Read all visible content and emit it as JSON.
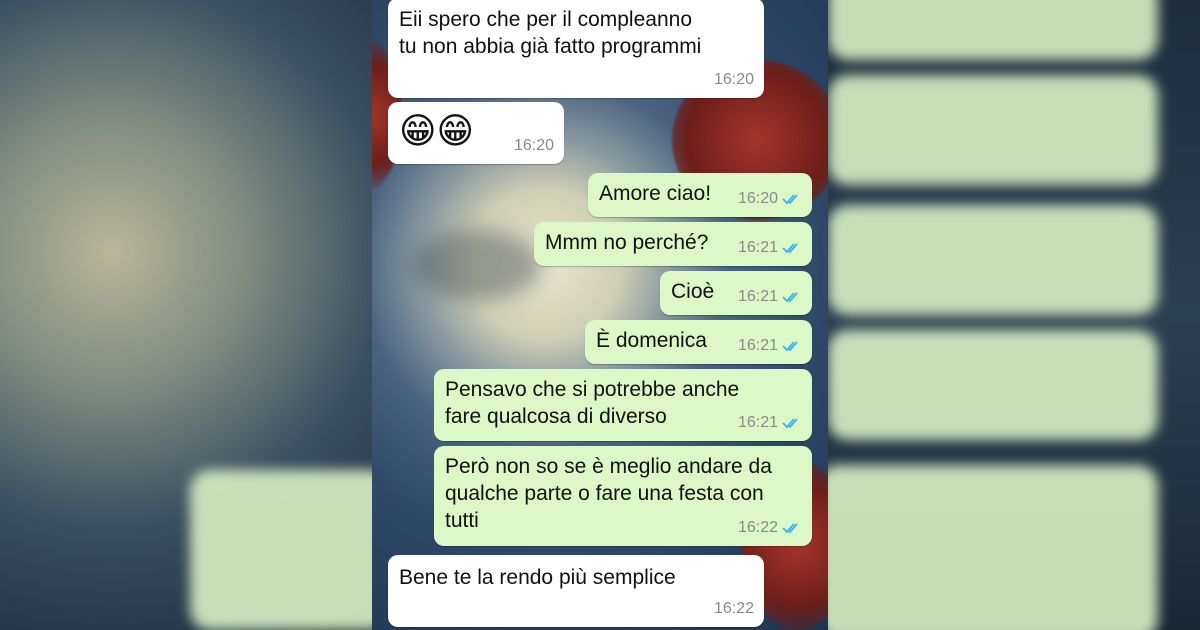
{
  "messages": [
    {
      "dir": "in",
      "lines": [
        "Eii spero che per il compleanno",
        "tu non abbia già fatto programmi"
      ],
      "time": "16:20"
    },
    {
      "dir": "in",
      "emoji": "😁😁",
      "time": "16:20"
    },
    {
      "dir": "out",
      "lines": [
        "Amore ciao!"
      ],
      "time": "16:20",
      "read": true
    },
    {
      "dir": "out",
      "lines": [
        "Mmm no perché?"
      ],
      "time": "16:21",
      "read": true
    },
    {
      "dir": "out",
      "lines": [
        "Cioè"
      ],
      "time": "16:21",
      "read": true
    },
    {
      "dir": "out",
      "lines": [
        "È domenica"
      ],
      "time": "16:21",
      "read": true
    },
    {
      "dir": "out",
      "lines": [
        "Pensavo che si potrebbe anche",
        "fare qualcosa di diverso"
      ],
      "time": "16:21",
      "read": true
    },
    {
      "dir": "out",
      "lines": [
        "Però non so se è meglio andare da",
        "qualche parte o fare una festa con",
        "tutti"
      ],
      "time": "16:22",
      "read": true
    },
    {
      "dir": "in",
      "lines": [
        "Bene te la rendo più semplice"
      ],
      "time": "16:22"
    }
  ],
  "colors": {
    "incoming_bubble": "#ffffff",
    "outgoing_bubble": "#dcf8c6",
    "read_ticks": "#34b7f1",
    "timestamp": "#8a8a8a"
  },
  "icons": {
    "read_receipt": "double-check-icon"
  }
}
